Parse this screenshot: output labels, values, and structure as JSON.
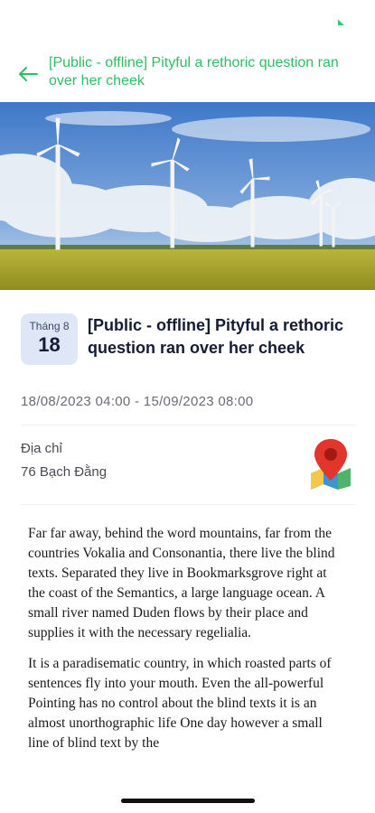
{
  "header": {
    "title": "[Public - offline] Pityful a rethoric question ran over her cheek",
    "accent_color": "#2ebd63"
  },
  "hero": {
    "image": "wind-turbines-field"
  },
  "event": {
    "month_label": "Tháng 8",
    "day": "18",
    "title": "[Public - offline] Pityful a rethoric question ran over her cheek",
    "date_range": "18/08/2023 04:00 - 15/09/2023 08:00"
  },
  "address": {
    "label": "Địa chỉ",
    "value": "76 Bạch Đằng",
    "map_icon": "map-pin-icon"
  },
  "content": {
    "paragraphs": [
      "Far far away, behind the word mountains, far from the countries Vokalia and Consonantia, there live the blind texts. Separated they live in Bookmarksgrove right at the coast of the Semantics, a large language ocean. A small river named Duden flows by their place and supplies it with the necessary regelialia.",
      "It is a paradisematic country, in which roasted parts of sentences fly into your mouth. Even the all-powerful Pointing has no control about the blind texts it is an almost unorthographic life One day however a small line of blind text by the"
    ]
  }
}
